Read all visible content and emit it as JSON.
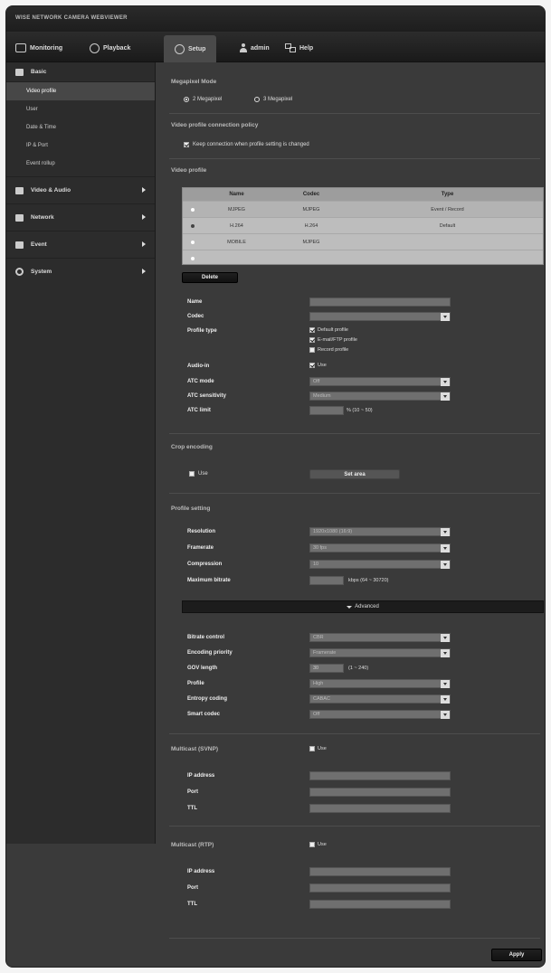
{
  "app_title": "WISE NETWORK CAMERA WEBVIEWER",
  "nav": {
    "monitoring": "Monitoring",
    "playback": "Playback",
    "setup": "Setup",
    "admin": "admin",
    "help": "Help"
  },
  "sidebar": {
    "basic": "Basic",
    "basic_items": [
      "Video profile",
      "User",
      "Date & Time",
      "IP & Port",
      "Event rollup"
    ],
    "groups": [
      "Video & Audio",
      "Network",
      "Event",
      "System"
    ]
  },
  "sections": {
    "megapixel_mode": "Megapixel Mode",
    "mode_options": [
      "2 Megapixel",
      "3 Megapixel"
    ],
    "connection_policy": "Video profile connection policy",
    "keep_connection": "Keep connection when profile setting is changed",
    "video_profile": "Video profile",
    "crop_encoding": "Crop encoding",
    "profile_setting": "Profile setting",
    "multicast_svnp": "Multicast (SVNP)",
    "multicast_rtp": "Multicast (RTP)"
  },
  "table": {
    "headers": [
      "Name",
      "Codec",
      "Type"
    ],
    "rows": [
      {
        "name": "MJPEG",
        "codec": "MJPEG",
        "type": "Event / Record"
      },
      {
        "name": "H.264",
        "codec": "H.264",
        "type": "Default"
      },
      {
        "name": "MOBILE",
        "codec": "MJPEG",
        "type": ""
      },
      {
        "name": "",
        "codec": "",
        "type": ""
      }
    ]
  },
  "buttons": {
    "delete": "Delete",
    "set_area": "Set area",
    "advanced": "Advanced",
    "apply": "Apply"
  },
  "form": {
    "name": "Name",
    "codec": "Codec",
    "profile_type": "Profile type",
    "profile_type_opts": [
      "Default profile",
      "E-mail/FTP profile",
      "Record profile"
    ],
    "audio_in": "Audio-in",
    "use": "Use",
    "atc_mode": "ATC mode",
    "atc_mode_val": "Off",
    "atc_sensitivity": "ATC sensitivity",
    "atc_sensitivity_val": "Medium",
    "atc_limit": "ATC limit",
    "atc_limit_hint": "% (10 ~ 50)",
    "resolution": "Resolution",
    "resolution_val": "1920x1080 (16:9)",
    "framerate": "Framerate",
    "framerate_val": "30 fps",
    "compression": "Compression",
    "compression_val": "10",
    "max_bitrate": "Maximum bitrate",
    "max_bitrate_hint": "kbps (64 ~ 30720)",
    "bitrate_control": "Bitrate control",
    "bitrate_control_val": "CBR",
    "encoding_priority": "Encoding priority",
    "encoding_priority_val": "Framerate",
    "gov_length": "GOV length",
    "gov_length_val": "30",
    "gov_hint": "(1 ~ 240)",
    "profile": "Profile",
    "profile_val": "High",
    "entropy": "Entropy coding",
    "entropy_val": "CABAC",
    "smart_codec": "Smart codec",
    "smart_codec_val": "Off",
    "ip_address": "IP address",
    "port": "Port",
    "ttl": "TTL"
  }
}
